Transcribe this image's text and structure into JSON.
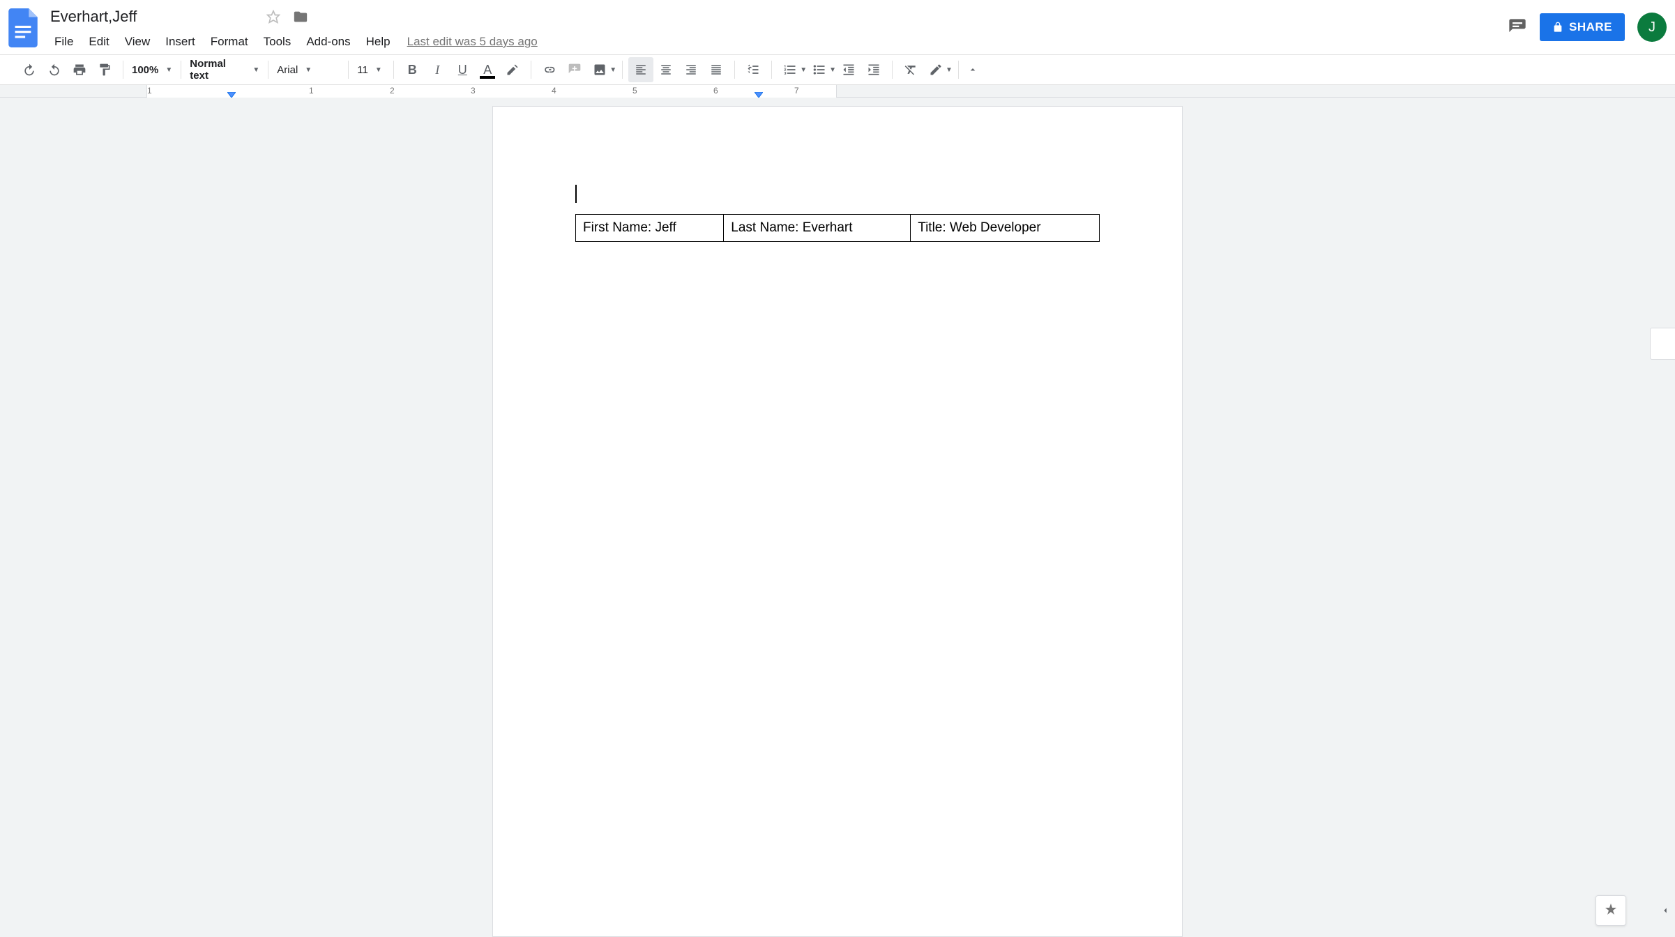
{
  "header": {
    "title": "Everhart,Jeff",
    "avatar_initial": "J",
    "share_label": "SHARE",
    "last_edit": "Last edit was 5 days ago"
  },
  "menu": {
    "items": [
      "File",
      "Edit",
      "View",
      "Insert",
      "Format",
      "Tools",
      "Add-ons",
      "Help"
    ]
  },
  "toolbar": {
    "zoom": "100%",
    "style": "Normal text",
    "font": "Arial",
    "size": "11"
  },
  "ruler": {
    "numbers": [
      "1",
      "1",
      "2",
      "3",
      "4",
      "5",
      "6",
      "7"
    ]
  },
  "document": {
    "table": {
      "cells": [
        "First Name: Jeff",
        "Last Name: Everhart",
        "Title: Web Developer"
      ]
    }
  }
}
